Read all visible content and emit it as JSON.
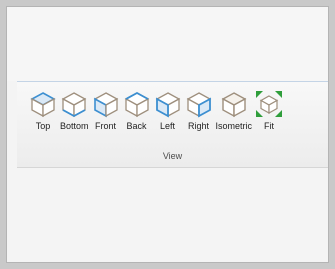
{
  "ribbon": {
    "group_label": "View",
    "buttons": [
      {
        "label": "Top",
        "icon": "cube-top-icon"
      },
      {
        "label": "Bottom",
        "icon": "cube-bottom-icon"
      },
      {
        "label": "Front",
        "icon": "cube-front-icon"
      },
      {
        "label": "Back",
        "icon": "cube-back-icon"
      },
      {
        "label": "Left",
        "icon": "cube-left-icon"
      },
      {
        "label": "Right",
        "icon": "cube-right-icon"
      },
      {
        "label": "Isometric",
        "icon": "cube-isometric-icon"
      },
      {
        "label": "Fit",
        "icon": "fit-to-view-icon"
      }
    ]
  },
  "colors": {
    "cube_outline": "#9e8f7d",
    "cube_highlight": "#3c8fd1",
    "fit_arrows": "#2f9e3b"
  }
}
